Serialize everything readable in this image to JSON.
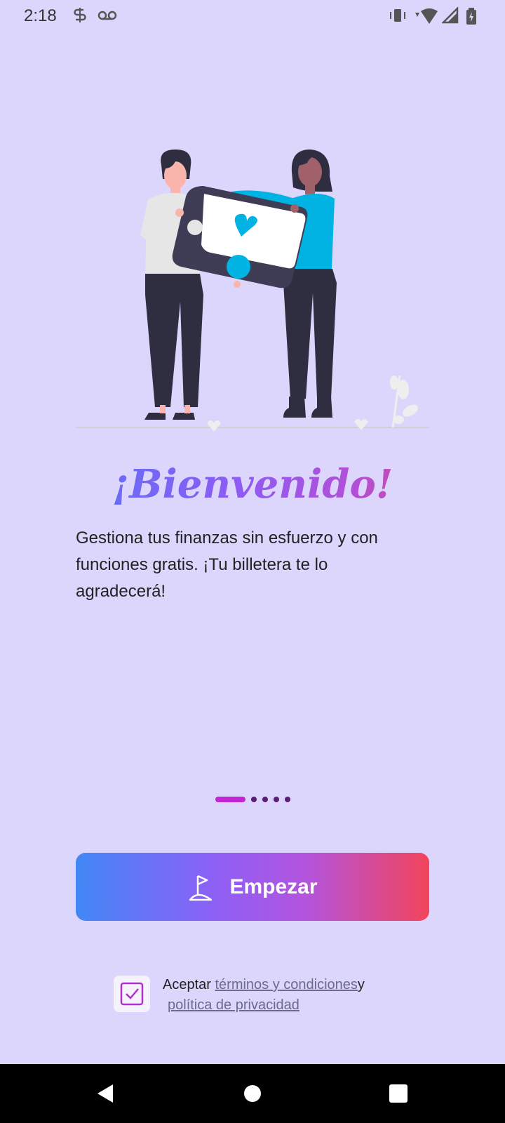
{
  "status_bar": {
    "time": "2:18",
    "icons": [
      "s-icon",
      "voicemail-icon",
      "vibrate-icon",
      "wifi-icon",
      "signal-icon",
      "battery-icon"
    ]
  },
  "welcome": {
    "title": "¡Bienvenido!",
    "description": "Gestiona tus finanzas sin esfuerzo y con funciones gratis. ¡Tu billetera te lo agradecerá!"
  },
  "pager": {
    "total": 5,
    "active": 0
  },
  "start_button": {
    "label": "Empezar",
    "icon": "flag-icon"
  },
  "terms": {
    "prefix": "Aceptar ",
    "terms_link": "términos y condiciones",
    "conjunction": "y",
    "privacy_link": "política de privacidad",
    "checked": true
  },
  "colors": {
    "background": "#dcd6fd",
    "gradient_start": "#4287f5",
    "gradient_mid": "#a855f7",
    "gradient_end": "#f2445b",
    "pager_active": "#c026d3",
    "illustration_accent": "#00b3e3"
  }
}
